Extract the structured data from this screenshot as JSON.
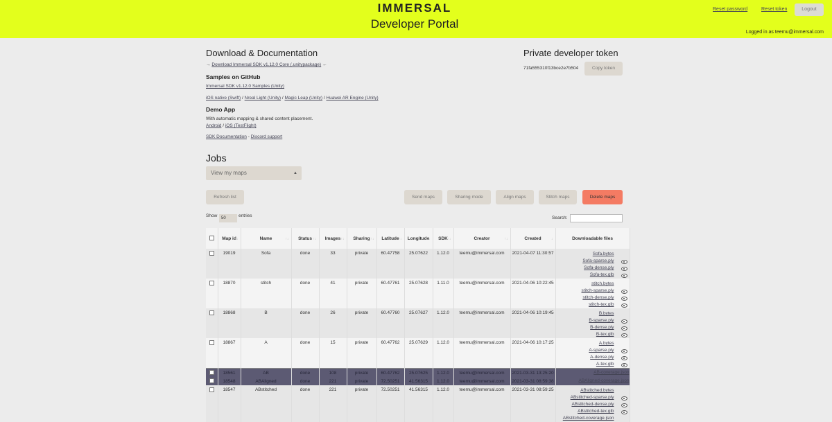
{
  "header": {
    "logo": "IMMERSAL",
    "portal_title": "Developer Portal",
    "reset_password": "Reset password",
    "reset_token": "Reset token",
    "logout": "Logout",
    "logged_in": "Logged in as teemu@immersal.com"
  },
  "download": {
    "title": "Download & Documentation",
    "sdk_prefix": "→",
    "sdk_link": "Download Immersal SDK v1.12.0 Core (.unitypackage)",
    "sdk_suffix": "←",
    "samples_title": "Samples on GitHub",
    "samples_unity": "Immersal SDK v1.12.0 Samples (Unity)",
    "ios_native": "iOS native (Swift)",
    "nreal": "Nreal Light (Unity)",
    "magic_leap": "Magic Leap (Unity)",
    "huawei": "Huawei AR Engine (Unity)",
    "sep": "/",
    "demo_title": "Demo App",
    "demo_desc": "With automatic mapping & shared content placement.",
    "android": "Android",
    "ios_testflight": "iOS (TestFlight)",
    "sdk_docs": "SDK Documentation",
    "dash": "-",
    "discord": "Discord support"
  },
  "token": {
    "title": "Private developer token",
    "value": "71fa555310f13bce2e7b504",
    "copy": "Copy token"
  },
  "jobs": {
    "title": "Jobs",
    "view_select": "View my maps",
    "refresh": "Refresh list",
    "send": "Send maps",
    "sharing": "Sharing mode",
    "align": "Align maps",
    "stitch": "Stitch maps",
    "delete": "Delete maps",
    "show": "Show",
    "entries_count": "50",
    "entries": "entries",
    "search": "Search:"
  },
  "table": {
    "headers": [
      "Map id",
      "Name",
      "Status",
      "Images",
      "Sharing",
      "Latitude",
      "Longitude",
      "SDK",
      "Creator",
      "Created",
      "Downloadable files"
    ],
    "rows": [
      {
        "id": "19019",
        "name": "Sofa",
        "status": "done",
        "images": "33",
        "sharing": "private",
        "lat": "60.47758",
        "lon": "25.07622",
        "sdk": "1.12.0",
        "creator": "teemu@immersal.com",
        "created": "2021-04-07 11:30:57",
        "files": [
          "Sofa.bytes",
          "Sofa-sparse.ply",
          "Sofa-dense.ply",
          "Sofa-tex.glb"
        ]
      },
      {
        "id": "18870",
        "name": "stitch",
        "status": "done",
        "images": "41",
        "sharing": "private",
        "lat": "60.47761",
        "lon": "25.07628",
        "sdk": "1.11.0",
        "creator": "teemu@immersal.com",
        "created": "2021-04-06 10:22:45",
        "files": [
          "stitch.bytes",
          "stitch-sparse.ply",
          "stitch-dense.ply",
          "stitch-tex.glb"
        ]
      },
      {
        "id": "18868",
        "name": "B",
        "status": "done",
        "images": "26",
        "sharing": "private",
        "lat": "60.47760",
        "lon": "25.07627",
        "sdk": "1.12.0",
        "creator": "teemu@immersal.com",
        "created": "2021-04-06 10:19:45",
        "files": [
          "B.bytes",
          "B-sparse.ply",
          "B-dense.ply",
          "B-tex.glb"
        ]
      },
      {
        "id": "18867",
        "name": "A",
        "status": "done",
        "images": "15",
        "sharing": "private",
        "lat": "60.47762",
        "lon": "25.07629",
        "sdk": "1.12.0",
        "creator": "teemu@immersal.com",
        "created": "2021-04-06 10:17:25",
        "files": [
          "A.bytes",
          "A-sparse.ply",
          "A-dense.ply",
          "A-tex.glb"
        ]
      },
      {
        "id": "18561",
        "name": "AB",
        "status": "done",
        "images": "108",
        "sharing": "private",
        "lat": "60.47762",
        "lon": "25.07625",
        "sdk": "1.12.0",
        "creator": "teemu@immersal.com",
        "created": "2021-03-31 13:25:20",
        "files": [
          "AB-coverage.json"
        ]
      },
      {
        "id": "18548",
        "name": "ABAligned",
        "status": "done",
        "images": "221",
        "sharing": "private",
        "lat": "72.50251",
        "lon": "41.56315",
        "sdk": "1.12.0",
        "creator": "teemu@immersal.com",
        "created": "2021-03-31 08:59:38",
        "files": [
          "ABAligned-coverage.json"
        ]
      },
      {
        "id": "18547",
        "name": "ABstitched",
        "status": "done",
        "images": "221",
        "sharing": "private",
        "lat": "72.50251",
        "lon": "41.56315",
        "sdk": "1.12.0",
        "creator": "teemu@immersal.com",
        "created": "2021-03-31 08:59:25",
        "files": [
          "ABstitched.bytes",
          "ABstitched-sparse.ply",
          "ABstitched-dense.ply",
          "ABstitched-tex.glb",
          "ABstitched-coverage.json"
        ]
      }
    ]
  }
}
